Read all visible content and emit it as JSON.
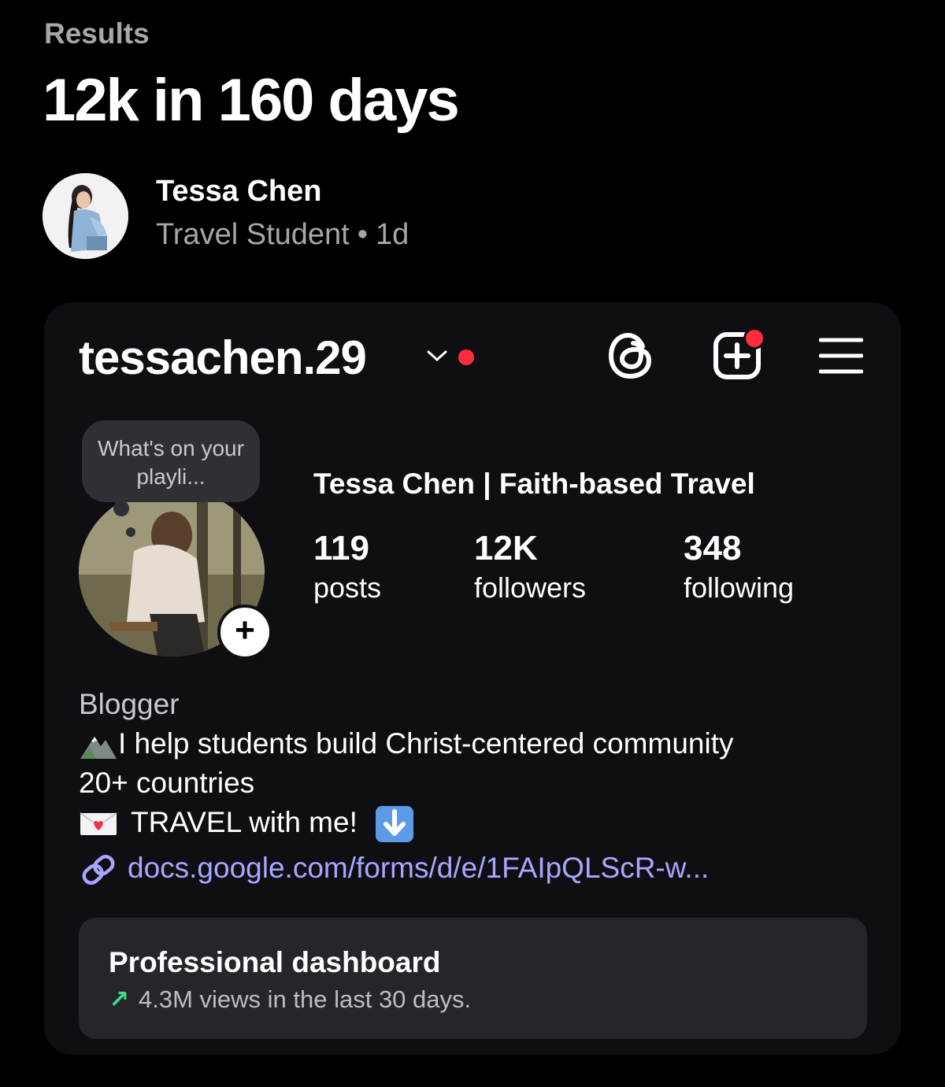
{
  "section_label": "Results",
  "headline": "12k in 160 days",
  "author": {
    "name": "Tessa Chen",
    "role": "Travel Student",
    "separator": "•",
    "time": "1d"
  },
  "profile": {
    "username": "tessachen.29",
    "note": "What's on your playli...",
    "display_name": "Tessa Chen | Faith-based Travel",
    "stats": [
      {
        "value": "119",
        "label": "posts"
      },
      {
        "value": "12K",
        "label": "followers"
      },
      {
        "value": "348",
        "label": "following"
      }
    ],
    "bio": {
      "category": "Blogger",
      "line1": "I help students build Christ-centered community",
      "line2": "20+ countries",
      "line3": "TRAVEL with me!",
      "link": "docs.google.com/forms/d/e/1FAIpQLScR-w..."
    },
    "dashboard": {
      "title": "Professional dashboard",
      "subtitle": "4.3M views in the last 30 days.",
      "trend_icon": "↗"
    }
  },
  "colors": {
    "background": "#000000",
    "card": "#0f0f13",
    "notification": "#ff2d3d",
    "link": "#a9a6ff",
    "trend": "#3ddc84"
  }
}
